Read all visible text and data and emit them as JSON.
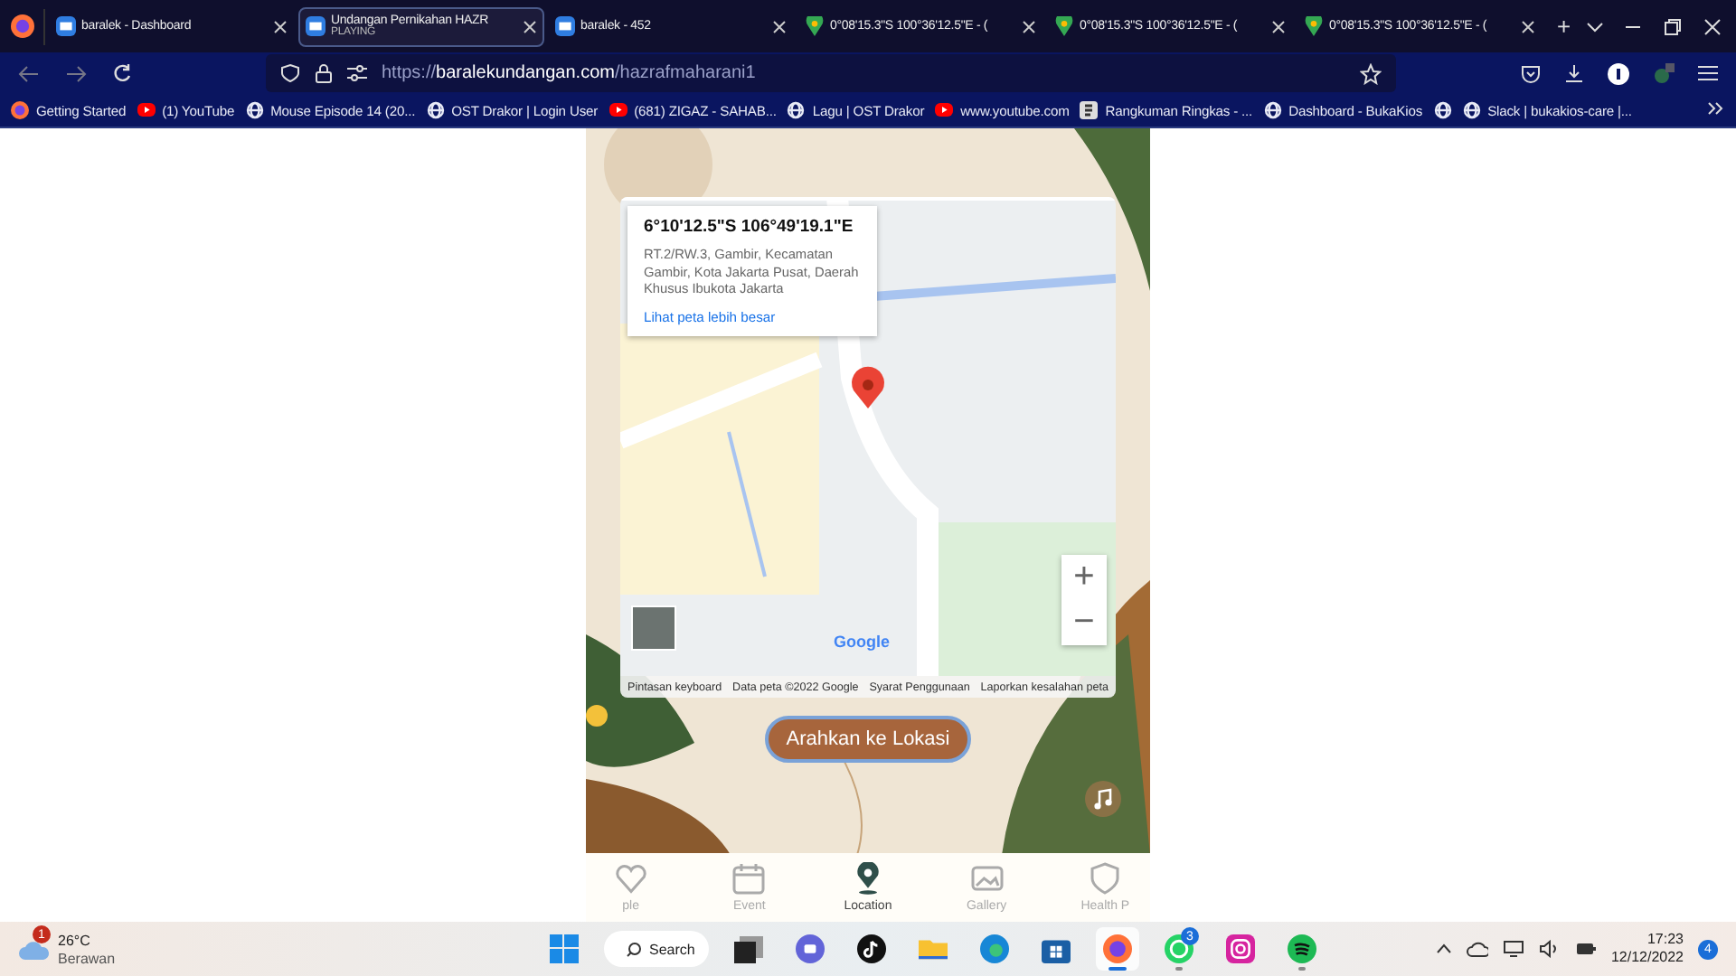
{
  "browser": {
    "tabs": [
      {
        "kind": "site",
        "title": "baralek - Dashboard",
        "selected": false
      },
      {
        "kind": "site",
        "title": "Undangan Pernikahan HAZR",
        "subtitle": "PLAYING",
        "selected": true
      },
      {
        "kind": "site",
        "title": "baralek - 452",
        "selected": false
      },
      {
        "kind": "maps",
        "title": "0°08'15.3\"S 100°36'12.5\"E - (",
        "selected": false
      },
      {
        "kind": "maps",
        "title": "0°08'15.3\"S 100°36'12.5\"E - (",
        "selected": false
      },
      {
        "kind": "maps",
        "title": "0°08'15.3\"S 100°36'12.5\"E - (",
        "selected": false
      }
    ],
    "new_tab": "+",
    "url": "https://**baralekundangan.com**/hazrafmaharani1",
    "bookmarks": [
      {
        "kind": "firefox",
        "label": "Getting Started"
      },
      {
        "kind": "youtube",
        "label": "(1) YouTube"
      },
      {
        "kind": "globe",
        "label": "Mouse Episode 14 (20..."
      },
      {
        "kind": "globe",
        "label": "OST Drakor | Login User"
      },
      {
        "kind": "youtube",
        "label": "(681) ZIGAZ - SAHAB..."
      },
      {
        "kind": "globe",
        "label": "Lagu | OST Drakor"
      },
      {
        "kind": "youtube",
        "label": "www.youtube.com"
      },
      {
        "kind": "doc",
        "label": "Rangkuman Ringkas - ..."
      },
      {
        "kind": "globe",
        "label": "Dashboard - BukaKios"
      },
      {
        "kind": "globe"
      },
      {
        "kind": "globe",
        "label": "Slack | bukakios-care |..."
      }
    ]
  },
  "page": {
    "map": {
      "info_card": {
        "title": "6°10'12.5\"S 106°49'19.1\"E",
        "address": "RT.2/RW.3, Gambir, Kecamatan Gambir, Kota Jakarta Pusat, Daerah Khusus Ibukota Jakarta",
        "link": "Lihat peta lebih besar"
      },
      "zoom_in": "+",
      "zoom_out": "−",
      "logo": "Google",
      "attribution": [
        "Pintasan keyboard",
        "Data peta ©2022 Google",
        "Syarat Penggunaan",
        "Laporkan kesalahan peta"
      ]
    },
    "direction_button": "Arahkan ke Lokasi",
    "bottom_nav": [
      {
        "kind": "heart",
        "label": "ple",
        "selected": false
      },
      {
        "kind": "calendar",
        "label": "Event",
        "selected": false
      },
      {
        "kind": "pin",
        "label": "Location",
        "selected": true
      },
      {
        "kind": "image",
        "label": "Gallery",
        "selected": false
      },
      {
        "kind": "shield",
        "label": "Health P",
        "selected": false
      }
    ]
  },
  "taskbar": {
    "weather": {
      "badge": "1",
      "temperature": "26°C",
      "condition": "Berawan"
    },
    "search": "Search",
    "apps": [
      {
        "kind": "start",
        "selected": false,
        "running": false
      },
      {
        "kind": "search"
      },
      {
        "kind": "taskview",
        "selected": false,
        "running": false
      },
      {
        "kind": "chat",
        "selected": false,
        "running": false
      },
      {
        "kind": "tiktok",
        "selected": false,
        "running": false
      },
      {
        "kind": "folder",
        "selected": false,
        "running": false
      },
      {
        "kind": "edge",
        "selected": false,
        "running": false
      },
      {
        "kind": "store",
        "selected": false,
        "running": false
      },
      {
        "kind": "firefox",
        "selected": true,
        "running": true
      },
      {
        "kind": "whatsapp",
        "badge": "3",
        "selected": false,
        "running": true
      },
      {
        "kind": "instagram",
        "selected": false,
        "running": false
      },
      {
        "kind": "spotify",
        "selected": false,
        "running": true
      }
    ],
    "time": "17:23",
    "date": "12/12/2022",
    "notifications": "4"
  }
}
